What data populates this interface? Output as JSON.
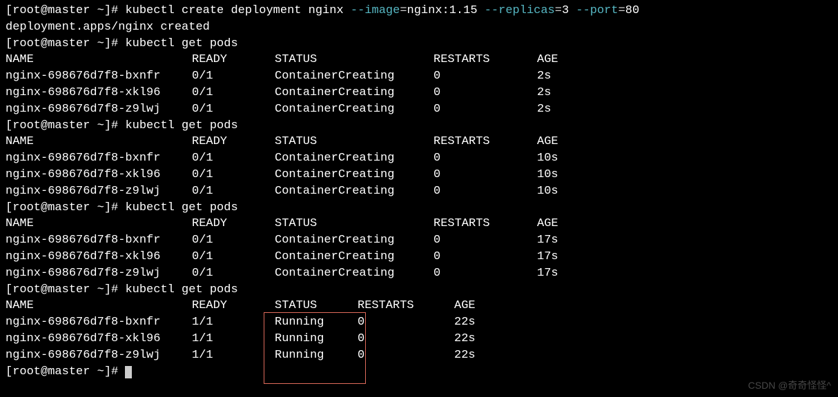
{
  "prompt": {
    "open": "[",
    "userhost": "root@master ~",
    "close": "]",
    "hash": "# "
  },
  "cmd1": {
    "base": "kubectl create deployment nginx ",
    "flag_image": "--image",
    "eq1": "=",
    "val_image": "nginx:1.15 ",
    "flag_replicas": "--replicas",
    "eq2": "=",
    "val_replicas": "3 ",
    "flag_port": "--port",
    "eq3": "=",
    "val_port": "80"
  },
  "output1": "deployment.apps/nginx created",
  "cmd_getpods": "kubectl get pods",
  "header_wide": {
    "name": "NAME",
    "ready": "READY",
    "status": "STATUS",
    "restarts": "RESTARTS",
    "age": "AGE"
  },
  "tables": [
    {
      "rows": [
        {
          "name": "nginx-698676d7f8-bxnfr",
          "ready": "0/1",
          "status": "ContainerCreating",
          "restarts": "0",
          "age": "2s"
        },
        {
          "name": "nginx-698676d7f8-xkl96",
          "ready": "0/1",
          "status": "ContainerCreating",
          "restarts": "0",
          "age": "2s"
        },
        {
          "name": "nginx-698676d7f8-z9lwj",
          "ready": "0/1",
          "status": "ContainerCreating",
          "restarts": "0",
          "age": "2s"
        }
      ]
    },
    {
      "rows": [
        {
          "name": "nginx-698676d7f8-bxnfr",
          "ready": "0/1",
          "status": "ContainerCreating",
          "restarts": "0",
          "age": "10s"
        },
        {
          "name": "nginx-698676d7f8-xkl96",
          "ready": "0/1",
          "status": "ContainerCreating",
          "restarts": "0",
          "age": "10s"
        },
        {
          "name": "nginx-698676d7f8-z9lwj",
          "ready": "0/1",
          "status": "ContainerCreating",
          "restarts": "0",
          "age": "10s"
        }
      ]
    },
    {
      "rows": [
        {
          "name": "nginx-698676d7f8-bxnfr",
          "ready": "0/1",
          "status": "ContainerCreating",
          "restarts": "0",
          "age": "17s"
        },
        {
          "name": "nginx-698676d7f8-xkl96",
          "ready": "0/1",
          "status": "ContainerCreating",
          "restarts": "0",
          "age": "17s"
        },
        {
          "name": "nginx-698676d7f8-z9lwj",
          "ready": "0/1",
          "status": "ContainerCreating",
          "restarts": "0",
          "age": "17s"
        }
      ]
    }
  ],
  "table_short": {
    "rows": [
      {
        "name": "nginx-698676d7f8-bxnfr",
        "ready": "1/1",
        "status": "Running",
        "restarts": "0",
        "age": "22s"
      },
      {
        "name": "nginx-698676d7f8-xkl96",
        "ready": "1/1",
        "status": "Running",
        "restarts": "0",
        "age": "22s"
      },
      {
        "name": "nginx-698676d7f8-z9lwj",
        "ready": "1/1",
        "status": "Running",
        "restarts": "0",
        "age": "22s"
      }
    ]
  },
  "watermark": "CSDN @奇奇怪怪^"
}
